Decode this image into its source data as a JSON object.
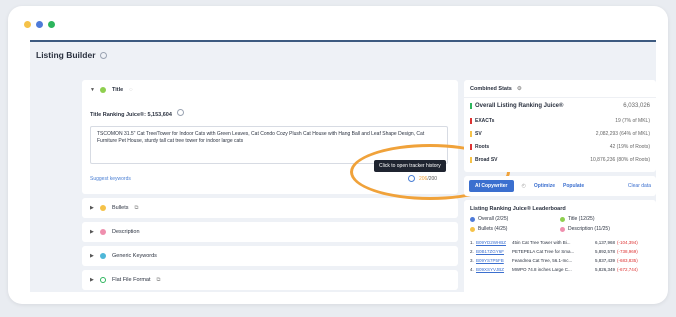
{
  "window": {
    "dots": [
      "#f5c249",
      "#4f7bd8",
      "#2db55d"
    ]
  },
  "header": {
    "title": "Listing Builder"
  },
  "title_section": {
    "label": "Title",
    "juice_label": "Title Ranking Juice",
    "juice_suffix": "®: ",
    "juice_value": "5,153,604",
    "text": "TSCOMON 31.5\" Cat Tree/Tower for Indoor Cats with Green Leaves, Cat Condo Cozy Plush Cat House with Hang Ball and Leaf Shape Design, Cat Furniture Pet House, sturdy tall cat tree tower for indoor large cats",
    "suggest_link": "Suggest keywords",
    "char_count": "206",
    "char_max": "/200",
    "tooltip": "Click to open tracker history"
  },
  "sections": [
    {
      "label": "Bullets",
      "color": "#f5c249"
    },
    {
      "label": "Description",
      "color": "#ef8fae"
    },
    {
      "label": "Generic Keywords",
      "color": "#4fb7d8"
    },
    {
      "label": "Flat File Format",
      "color": "#2db55d"
    }
  ],
  "combined_stats": {
    "title": "Combined Stats",
    "rows": [
      {
        "label": "Overall Listing Ranking Juice®",
        "value": "6,033,026",
        "color": "#2db55d"
      },
      {
        "label": "EXACTs",
        "value": "19 (7% of MKL)",
        "color": "#d33"
      },
      {
        "label": "SV",
        "value": "2,082,293 (64% of MKL)",
        "color": "#f5c249"
      },
      {
        "label": "Roots",
        "value": "42 (19% of Roots)",
        "color": "#d33"
      },
      {
        "label": "Broad SV",
        "value": "10,876,236 (80% of Roots)",
        "color": "#f5c249"
      }
    ]
  },
  "toolbar": {
    "ai_button": "AI Copywriter",
    "optimize": "Optimize",
    "populate": "Populate",
    "clear": "Clear data"
  },
  "leaderboard": {
    "title": "Listing Ranking Juice® Leaderboard",
    "legend": [
      {
        "label": "Overall (2/25)",
        "color": "#4f7bd8"
      },
      {
        "label": "Title (12/25)",
        "color": "#8fcf4f"
      },
      {
        "label": "Bullets (4/25)",
        "color": "#f5c249"
      },
      {
        "label": "Description (11/25)",
        "color": "#ef8fae"
      }
    ],
    "rows": [
      {
        "rank": "1.",
        "asin": "B09YD2WHBZ",
        "name": "45in Cat Tree Tower with Bi...",
        "score": "6,137,968",
        "delta": "(-104,394)"
      },
      {
        "rank": "2.",
        "asin": "B0B17ZGY6F",
        "name": "PETEPELA Cat Tree for Sma...",
        "score": "5,892,578",
        "delta": "(-738,969)"
      },
      {
        "rank": "3.",
        "asin": "B09YS7P5FB",
        "name": "Feandrea Cat Tree, 56.1-Inc...",
        "score": "5,837,439",
        "delta": "(-683,835)"
      },
      {
        "rank": "4.",
        "asin": "B09XSYVJBZ",
        "name": "MWPO 74.8 inches Large C...",
        "score": "5,826,349",
        "delta": "(-672,744)"
      }
    ]
  }
}
